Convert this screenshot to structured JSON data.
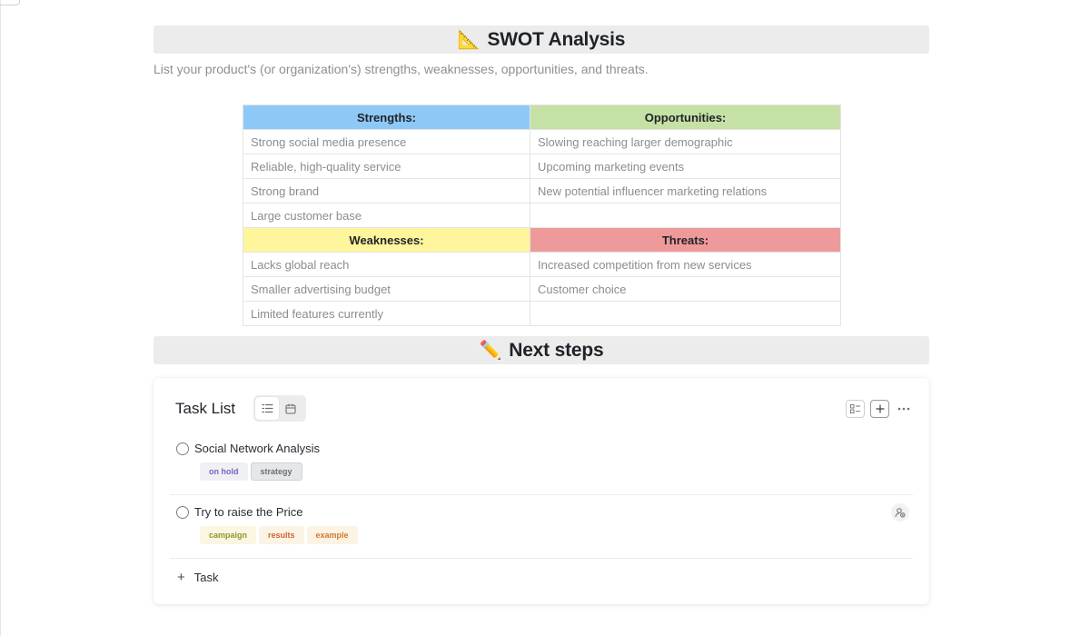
{
  "swot_section": {
    "emoji": "📐",
    "title": "SWOT Analysis",
    "subtitle": "List your product's (or organization's) strengths, weaknesses, opportunities, and threats."
  },
  "swot_table": {
    "strengths_header": "Strengths:",
    "opportunities_header": "Opportunities:",
    "weaknesses_header": "Weaknesses:",
    "threats_header": "Threats:",
    "strengths": [
      "Strong social media presence",
      "Reliable, high-quality service",
      "Strong brand",
      "Large customer base"
    ],
    "opportunities": [
      "Slowing reaching larger demographic",
      "Upcoming marketing events",
      "New potential influencer marketing relations",
      ""
    ],
    "weaknesses": [
      "Lacks global reach",
      "Smaller advertising budget",
      "Limited features currently"
    ],
    "threats": [
      "Increased competition from new services",
      "Customer choice",
      ""
    ],
    "colors": {
      "strengths": "#8ec8f6",
      "opportunities": "#c5e1a5",
      "weaknesses": "#fff59d",
      "threats": "#ef9a9a"
    }
  },
  "next_section": {
    "emoji": "✏️",
    "title": "Next steps"
  },
  "task_list": {
    "title": "Task List",
    "views": [
      "list-view-icon",
      "calendar-icon"
    ],
    "active_view": "list-view-icon",
    "toolbar_icons": [
      "layout-icon",
      "plus-icon",
      "more-icon"
    ],
    "tasks": [
      {
        "name": "Social Network Analysis",
        "tags": [
          "on hold",
          "strategy"
        ],
        "assignee_icon": false
      },
      {
        "name": "Try to raise the Price",
        "tags": [
          "campaign",
          "results",
          "example"
        ],
        "assignee_icon": true
      }
    ],
    "add_task_label": "Task"
  }
}
